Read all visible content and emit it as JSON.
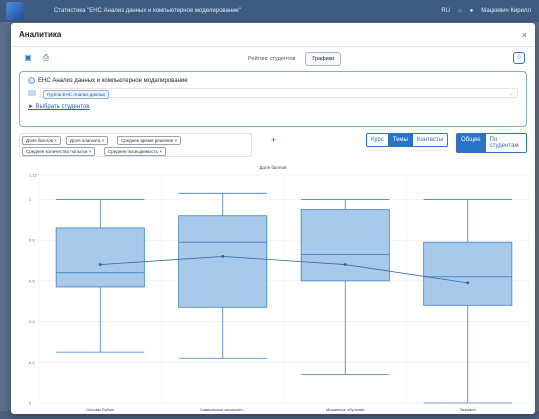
{
  "window": {
    "course_title": "Статистика \"ЕНС Анализ данных и компьютерное моделирование\"",
    "user_name": "Мацкевич Кирилл"
  },
  "modal": {
    "title": "Аналитика",
    "close_label": "×",
    "tabs": [
      {
        "label": "Рейтинг студентов",
        "active": false
      },
      {
        "label": "Графики",
        "active": true
      }
    ],
    "course_name": "ЕНС Анализ данных и компьютерное моделирование",
    "group_chip": "Группа ЕНС Анализ данных",
    "select_students_link": "► Выбрать студентов"
  },
  "metrics": [
    "Доля баллов ×",
    "Доля плагиата ×",
    "Среднее время решения ×",
    "Среднее количество попыток ×",
    "Среднее посещаемость ×"
  ],
  "add_metric_label": "+",
  "scope_buttons": [
    {
      "label": "Курс",
      "active": false
    },
    {
      "label": "Темы",
      "active": true
    },
    {
      "label": "Контесты",
      "active": false
    }
  ],
  "aggregation_buttons": [
    {
      "label": "Общее",
      "active": true
    },
    {
      "label": "По студентам",
      "active": false
    }
  ],
  "icons": [
    "calendar-icon",
    "print-icon",
    "users-icon",
    "course-icon",
    "group-icon"
  ],
  "colors": {
    "accent": "#2a73c7",
    "box_fill": "#a9c9ea",
    "box_stroke": "#3b82c4",
    "mean_line": "#2f6fad"
  },
  "chart_data": {
    "type": "box",
    "title": "Доля баллов",
    "categories": [
      "Основы Python",
      "Символьные вычислен...",
      "Машинное обучение",
      "Экзамен"
    ],
    "ylim": [
      0,
      1.12
    ],
    "yticks": [
      0,
      0.2,
      0.4,
      0.6,
      0.8,
      1,
      1.12
    ],
    "ytick_labels": [
      "0",
      "0.2",
      "0.4",
      "0.6",
      "0.8",
      "1",
      "1.12"
    ],
    "boxes": [
      {
        "min": 0.25,
        "q1": 0.57,
        "median": 0.64,
        "q3": 0.86,
        "max": 1.0
      },
      {
        "min": 0.22,
        "q1": 0.47,
        "median": 0.79,
        "q3": 0.92,
        "max": 1.03
      },
      {
        "min": 0.14,
        "q1": 0.6,
        "median": 0.73,
        "q3": 0.95,
        "max": 1.0
      },
      {
        "min": 0.0,
        "q1": 0.48,
        "median": 0.62,
        "q3": 0.79,
        "max": 1.0
      }
    ],
    "means": [
      0.68,
      0.72,
      0.68,
      0.59
    ],
    "grid": true
  }
}
